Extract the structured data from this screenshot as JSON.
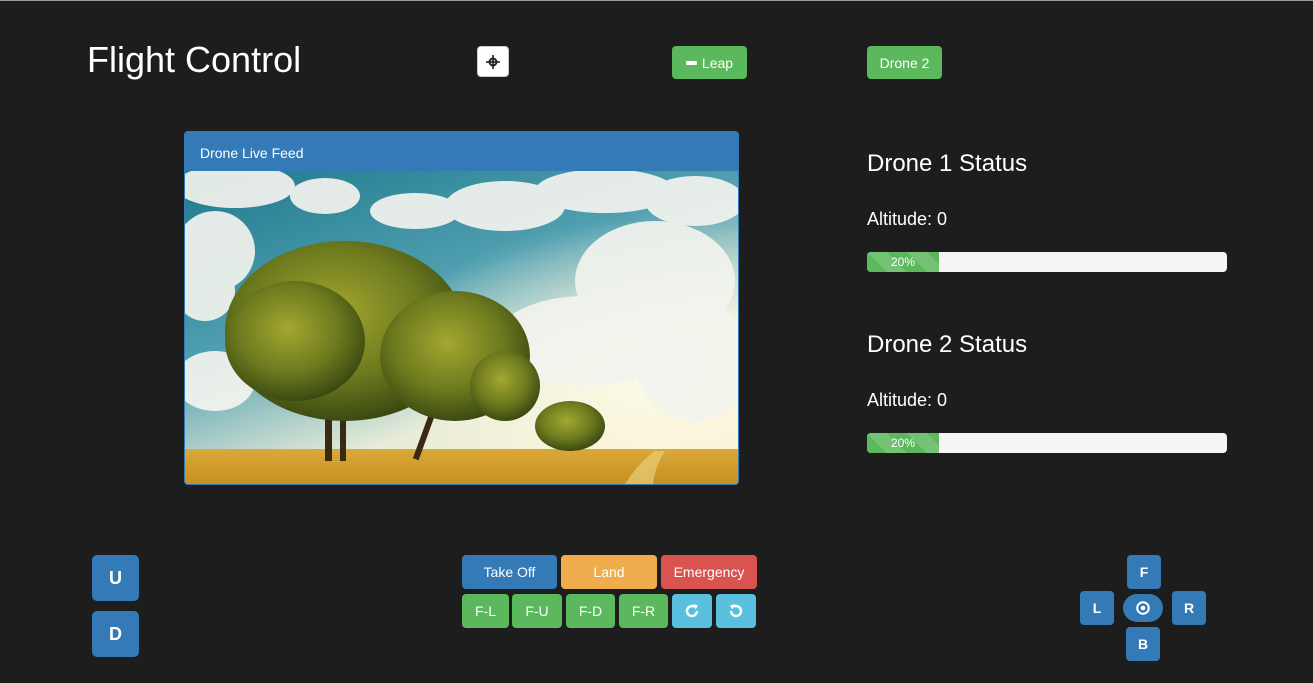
{
  "header": {
    "title": "Flight Control",
    "crosshair_icon": "crosshair-icon",
    "leap_label": "Leap",
    "leap_icon": "minus-icon",
    "drone2_label": "Drone 2"
  },
  "feed": {
    "heading": "Drone Live Feed",
    "image_description": "Landscape: trees in a golden field under a blue sky with white clouds"
  },
  "drones": [
    {
      "title": "Drone 1 Status",
      "altitude_label": "Altitude: 0",
      "progress_percent": 20,
      "progress_label": "20%"
    },
    {
      "title": "Drone 2 Status",
      "altitude_label": "Altitude: 0",
      "progress_percent": 20,
      "progress_label": "20%"
    }
  ],
  "vertical_controls": {
    "up": "U",
    "down": "D"
  },
  "main_controls": {
    "takeoff": "Take Off",
    "land": "Land",
    "emergency": "Emergency",
    "flips": [
      "F-L",
      "F-U",
      "F-D",
      "F-R"
    ],
    "rotate_cw_icon": "rotate-cw-icon",
    "rotate_ccw_icon": "rotate-ccw-icon"
  },
  "direction_pad": {
    "forward": "F",
    "left": "L",
    "right": "R",
    "back": "B",
    "center_icon": "target-icon"
  },
  "colors": {
    "background": "#1d1d1d",
    "primary": "#337ab7",
    "success": "#5cb85c",
    "warning": "#f0ad4e",
    "danger": "#d9534f",
    "info": "#5bc0de"
  }
}
